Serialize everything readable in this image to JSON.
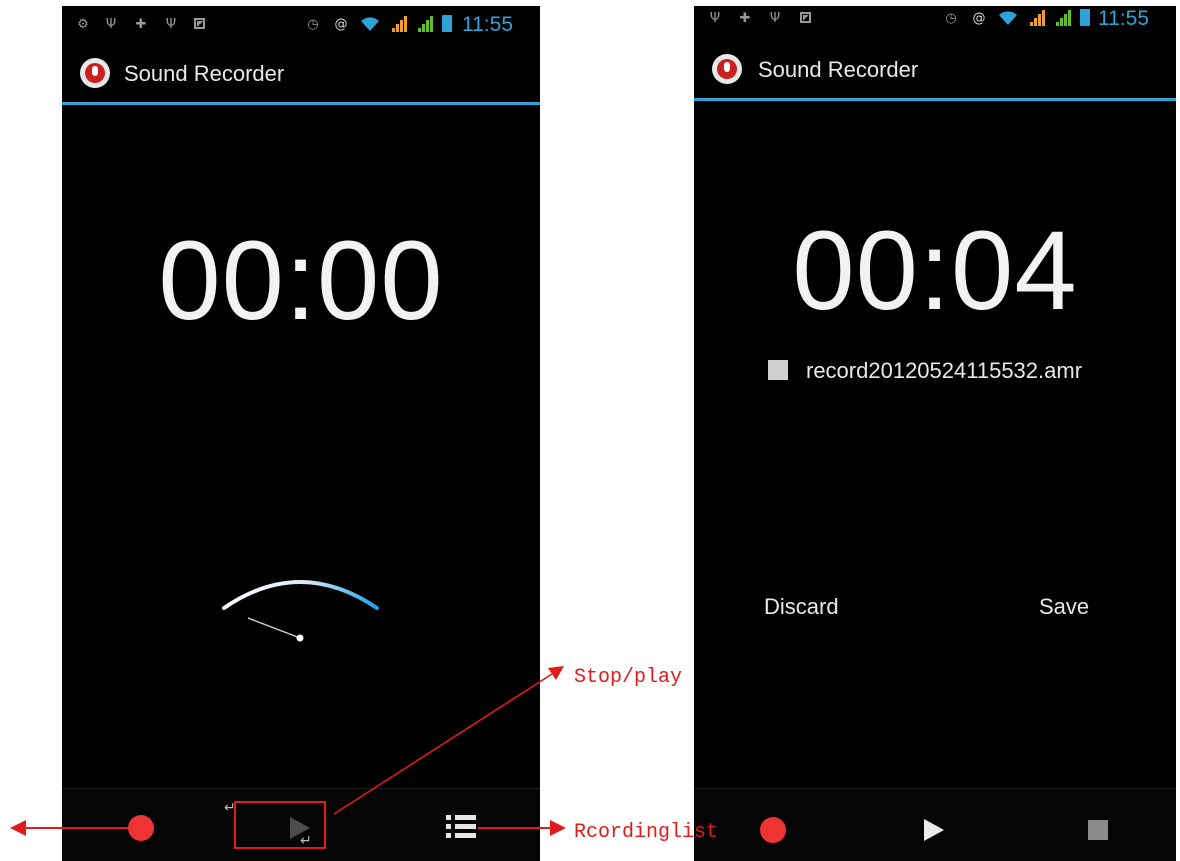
{
  "status_bar": {
    "time": "11:55",
    "left_icons": [
      "settings-icon",
      "usb-icon",
      "android-debug-icon",
      "usb-icon",
      "gallery-icon"
    ],
    "right_icons": [
      "alarm-icon",
      "sync-icon",
      "wifi-icon",
      "signal-icon",
      "signal-icon",
      "battery-icon"
    ],
    "accent_color": "#2ea3d8",
    "signal_color": "#f0a030"
  },
  "app": {
    "title": "Sound Recorder",
    "icon": "microphone-icon"
  },
  "left_screen": {
    "timer": "00:00",
    "meter_icon": "vu-meter-icon",
    "controls": [
      "record-icon",
      "play-icon",
      "recording-list-icon"
    ]
  },
  "right_screen": {
    "timer": "00:04",
    "file_name": "record20120524115532.amr",
    "discard_label": "Discard",
    "save_label": "Save",
    "controls": [
      "record-icon",
      "play-icon",
      "stop-icon"
    ]
  },
  "annotations": {
    "stop_play": "Stop/play",
    "recording_list": "Rcordinglist",
    "color": "#e01b1b"
  }
}
